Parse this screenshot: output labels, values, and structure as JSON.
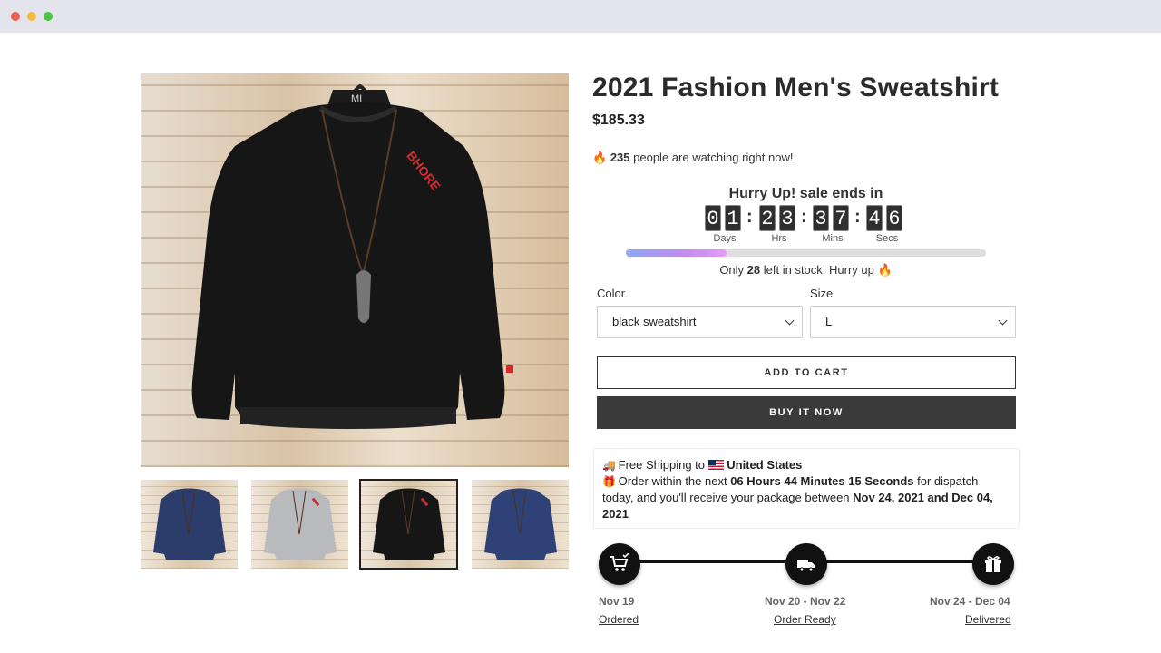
{
  "product": {
    "title": "2021 Fashion Men's Sweatshirt",
    "price": "$185.33",
    "watching_count": "235",
    "watching_text": "people are watching right now!",
    "flame": "🔥"
  },
  "countdown": {
    "heading": "Hurry Up! sale ends in",
    "days": [
      "0",
      "1"
    ],
    "hours": [
      "2",
      "3"
    ],
    "minutes": [
      "3",
      "7"
    ],
    "seconds": [
      "4",
      "6"
    ],
    "separator": ":",
    "labels": {
      "days": "Days",
      "hours": "Hrs",
      "minutes": "Mins",
      "seconds": "Secs"
    }
  },
  "stock": {
    "prefix": "Only",
    "count": "28",
    "suffix": "left in stock. Hurry up",
    "level_fraction": 0.28
  },
  "options": {
    "color_label": "Color",
    "color_value": "black sweatshirt",
    "size_label": "Size",
    "size_value": "L"
  },
  "buttons": {
    "add_to_cart": "ADD TO CART",
    "buy_now": "BUY IT NOW"
  },
  "shipping": {
    "line1_prefix": "Free Shipping to",
    "country": "United States",
    "line2_prefix": "Order within the next",
    "cutoff": "06 Hours 44 Minutes 15 Seconds",
    "line2_mid": "for dispatch today, and you'll receive your package between",
    "delivery_range": "Nov 24, 2021 and Dec 04, 2021"
  },
  "timeline": [
    {
      "date": "Nov 19",
      "label": "Ordered",
      "icon": "cart-check-icon"
    },
    {
      "date": "Nov 20 - Nov 22",
      "label": "Order Ready",
      "icon": "truck-icon"
    },
    {
      "date": "Nov 24 - Dec 04",
      "label": "Delivered",
      "icon": "gift-icon"
    }
  ],
  "gallery": {
    "main_variant": "black",
    "thumbnails": [
      {
        "variant": "navy",
        "selected": false
      },
      {
        "variant": "grey",
        "selected": false
      },
      {
        "variant": "black",
        "selected": true
      },
      {
        "variant": "navy",
        "selected": false
      }
    ]
  },
  "colors": {
    "button_dark": "#3a3a3a",
    "stock_bar_start": "#8ea7f2",
    "stock_bar_end": "#e39cf5"
  }
}
